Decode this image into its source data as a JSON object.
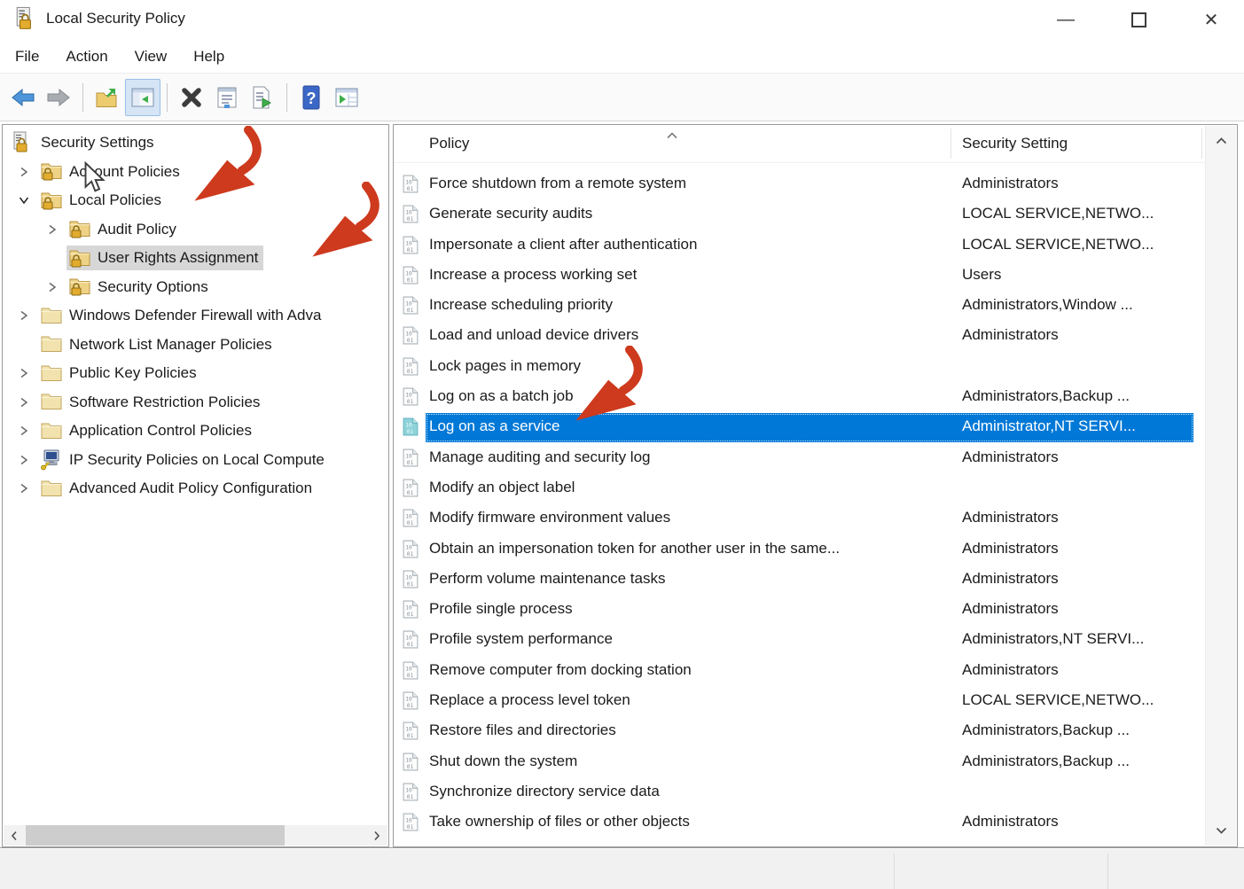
{
  "window": {
    "title": "Local Security Policy",
    "icon": "security-policy-app-icon",
    "controls": {
      "minimize_glyph": "—",
      "close_glyph": "✕"
    }
  },
  "menu_bar": {
    "items": [
      "File",
      "Action",
      "View",
      "Help"
    ]
  },
  "toolbar": {
    "buttons": [
      "back-icon",
      "forward-icon",
      "up-one-level-icon",
      "show-console-tree-icon",
      "delete-icon",
      "properties-icon",
      "export-list-icon",
      "help-icon",
      "new-window-icon"
    ],
    "active_button": "show-console-tree-icon"
  },
  "tree_panel": {
    "items": [
      {
        "label": "Security Settings",
        "level": 0,
        "icon": "security-root",
        "chevron": null
      },
      {
        "label": "Account Policies",
        "level": 1,
        "icon": "folder-lock",
        "chevron": "collapsed"
      },
      {
        "label": "Local Policies",
        "level": 1,
        "icon": "folder-lock",
        "chevron": "expanded"
      },
      {
        "label": "Audit Policy",
        "level": 2,
        "icon": "folder-lock",
        "chevron": "collapsed"
      },
      {
        "label": "User Rights Assignment",
        "level": 2,
        "icon": "folder-lock",
        "chevron": null,
        "selected": true
      },
      {
        "label": "Security Options",
        "level": 2,
        "icon": "folder-lock",
        "chevron": "collapsed"
      },
      {
        "label": "Windows Defender Firewall with Adva",
        "level": 1,
        "icon": "folder",
        "chevron": "collapsed"
      },
      {
        "label": "Network List Manager Policies",
        "level": 1,
        "icon": "folder",
        "chevron": null
      },
      {
        "label": "Public Key Policies",
        "level": 1,
        "icon": "folder",
        "chevron": "collapsed"
      },
      {
        "label": "Software Restriction Policies",
        "level": 1,
        "icon": "folder",
        "chevron": "collapsed"
      },
      {
        "label": "Application Control Policies",
        "level": 1,
        "icon": "folder",
        "chevron": "collapsed"
      },
      {
        "label": "IP Security Policies on Local Compute",
        "level": 1,
        "icon": "ipsec",
        "chevron": "collapsed"
      },
      {
        "label": "Advanced Audit Policy Configuration",
        "level": 1,
        "icon": "folder",
        "chevron": "collapsed"
      }
    ]
  },
  "list_panel": {
    "columns": [
      {
        "label": "Policy",
        "sort": "ascending"
      },
      {
        "label": "Security Setting"
      }
    ],
    "rows": [
      {
        "policy": "Force shutdown from a remote system",
        "setting": "Administrators"
      },
      {
        "policy": "Generate security audits",
        "setting": "LOCAL SERVICE,NETWO..."
      },
      {
        "policy": "Impersonate a client after authentication",
        "setting": "LOCAL SERVICE,NETWO..."
      },
      {
        "policy": "Increase a process working set",
        "setting": "Users"
      },
      {
        "policy": "Increase scheduling priority",
        "setting": "Administrators,Window ..."
      },
      {
        "policy": "Load and unload device drivers",
        "setting": "Administrators"
      },
      {
        "policy": "Lock pages in memory",
        "setting": ""
      },
      {
        "policy": "Log on as a batch job",
        "setting": "Administrators,Backup ..."
      },
      {
        "policy": "Log on as a service",
        "setting": "Administrator,NT SERVI...",
        "selected": true
      },
      {
        "policy": "Manage auditing and security log",
        "setting": "Administrators"
      },
      {
        "policy": "Modify an object label",
        "setting": ""
      },
      {
        "policy": "Modify firmware environment values",
        "setting": "Administrators"
      },
      {
        "policy": "Obtain an impersonation token for another user in the same...",
        "setting": "Administrators"
      },
      {
        "policy": "Perform volume maintenance tasks",
        "setting": "Administrators"
      },
      {
        "policy": "Profile single process",
        "setting": "Administrators"
      },
      {
        "policy": "Profile system performance",
        "setting": "Administrators,NT SERVI..."
      },
      {
        "policy": "Remove computer from docking station",
        "setting": "Administrators"
      },
      {
        "policy": "Replace a process level token",
        "setting": "LOCAL SERVICE,NETWO..."
      },
      {
        "policy": "Restore files and directories",
        "setting": "Administrators,Backup ..."
      },
      {
        "policy": "Shut down the system",
        "setting": "Administrators,Backup ..."
      },
      {
        "policy": "Synchronize directory service data",
        "setting": ""
      },
      {
        "policy": "Take ownership of files or other objects",
        "setting": "Administrators"
      }
    ]
  },
  "annotations": {
    "arrow_color": "#cd3a1d",
    "arrows": [
      {
        "points_at": "Local Policies"
      },
      {
        "points_at": "User Rights Assignment"
      },
      {
        "points_at": "Log on as a service"
      }
    ]
  },
  "colors": {
    "selection_blue": "#0078d7",
    "tree_selection_gray": "#d7d7d7",
    "toolbar_active_bg": "#d5e5f6"
  }
}
